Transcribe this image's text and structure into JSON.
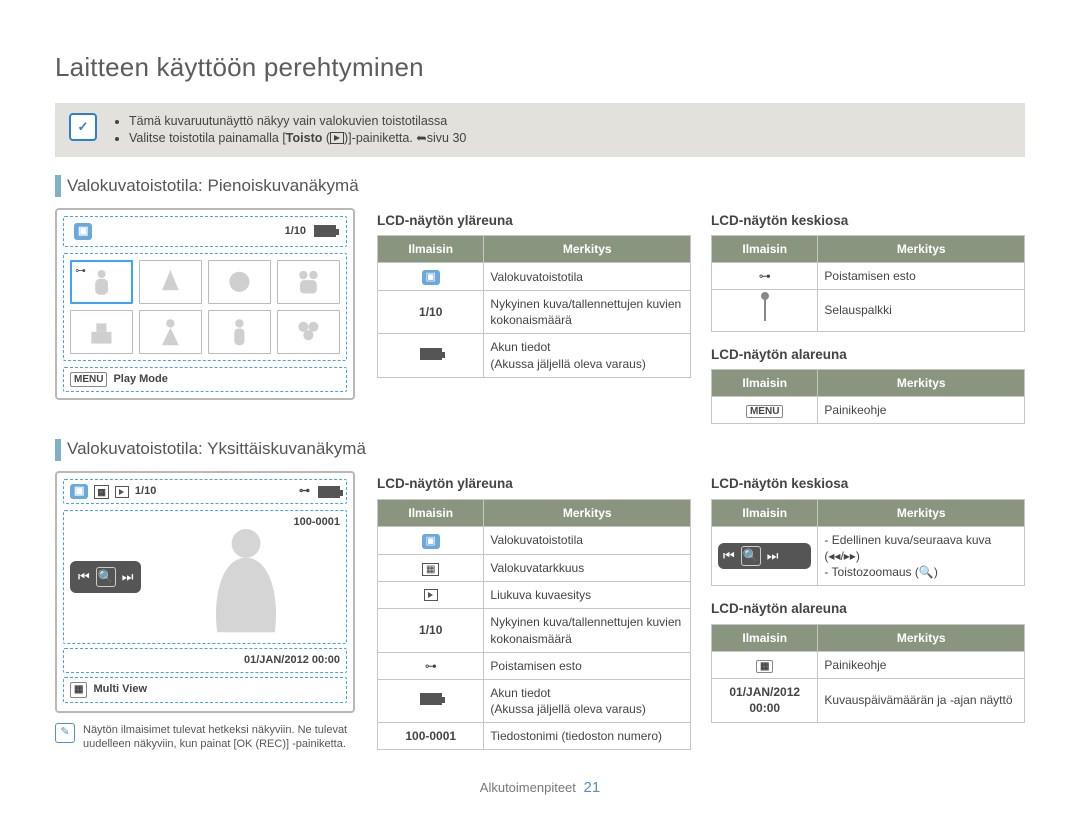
{
  "page": {
    "title": "Laitteen käyttöön perehtyminen",
    "footer_label": "Alkutoimenpiteet",
    "page_number": "21"
  },
  "info_box": {
    "line1": "Tämä kuvaruutunäyttö näkyy vain valokuvien toistotilassa",
    "line2_pre": "Valitse toistotila painamalla [",
    "line2_bold": "Toisto",
    "line2_mid": " (",
    "line2_post": ")]-painiketta. ",
    "line2_link": "sivu 30"
  },
  "section1": {
    "title": "Valokuvatoistotila: Pienoiskuvanäkymä",
    "lcd": {
      "counter": "1/10",
      "bottom_label": "Play Mode",
      "menu_chip": "MENU"
    },
    "top_table_title": "LCD-näytön yläreuna",
    "top_table": {
      "th1": "Ilmaisin",
      "th2": "Merkitys",
      "rows": [
        {
          "ind_type": "photo",
          "ind": "",
          "val": "Valokuvatoistotila"
        },
        {
          "ind_type": "text",
          "ind": "1/10",
          "val": "Nykyinen kuva/tallennettujen kuvien kokonaismäärä"
        },
        {
          "ind_type": "batt",
          "ind": "",
          "val": "Akun tiedot\n(Akussa jäljellä oleva varaus)"
        }
      ]
    },
    "mid_table_title": "LCD-näytön keskiosa",
    "mid_table": {
      "th1": "Ilmaisin",
      "th2": "Merkitys",
      "rows": [
        {
          "ind_type": "key",
          "ind": "",
          "val": "Poistamisen esto"
        },
        {
          "ind_type": "scroll",
          "ind": "",
          "val": "Selauspalkki"
        }
      ]
    },
    "bot_table_title": "LCD-näytön alareuna",
    "bot_table": {
      "th1": "Ilmaisin",
      "th2": "Merkitys",
      "rows": [
        {
          "ind_type": "menu",
          "ind": "MENU",
          "val": "Painikeohje"
        }
      ]
    }
  },
  "section2": {
    "title": "Valokuvatoistotila: Yksittäiskuvanäkymä",
    "lcd": {
      "counter": "1/10",
      "file": "100-0001",
      "date": "01/JAN/2012 00:00",
      "bottom_label": "Multi View",
      "bottom_chip": "▦"
    },
    "note": "Näytön ilmaisimet tulevat hetkeksi näkyviin. Ne tulevat uudelleen näkyviin, kun painat [OK (REC)] -painiketta.",
    "top_table_title": "LCD-näytön yläreuna",
    "top_table": {
      "th1": "Ilmaisin",
      "th2": "Merkitys",
      "rows": [
        {
          "ind_type": "photo",
          "ind": "",
          "val": "Valokuvatoistotila"
        },
        {
          "ind_type": "res",
          "ind": "",
          "val": "Valokuvatarkkuus"
        },
        {
          "ind_type": "play",
          "ind": "",
          "val": "Liukuva kuvaesitys"
        },
        {
          "ind_type": "text",
          "ind": "1/10",
          "val": "Nykyinen kuva/tallennettujen kuvien kokonaismäärä"
        },
        {
          "ind_type": "key",
          "ind": "",
          "val": "Poistamisen esto"
        },
        {
          "ind_type": "batt",
          "ind": "",
          "val": "Akun tiedot\n(Akussa jäljellä oleva varaus)"
        },
        {
          "ind_type": "text",
          "ind": "100-0001",
          "val": "Tiedostonimi (tiedoston numero)"
        }
      ]
    },
    "mid_table_title": "LCD-näytön keskiosa",
    "mid_table": {
      "th1": "Ilmaisin",
      "th2": "Merkitys",
      "rows": [
        {
          "ind_type": "nav",
          "ind": "",
          "val": "- Edellinen kuva/seuraava kuva\n   (◂◂/▸▸)\n- Toistozoomaus (🔍)"
        }
      ]
    },
    "bot_table_title": "LCD-näytön alareuna",
    "bot_table": {
      "th1": "Ilmaisin",
      "th2": "Merkitys",
      "rows": [
        {
          "ind_type": "chip",
          "ind": "▦",
          "val": "Painikeohje"
        },
        {
          "ind_type": "text",
          "ind": "01/JAN/2012 00:00",
          "val": "Kuvauspäivämäärän ja -ajan näyttö"
        }
      ]
    }
  }
}
